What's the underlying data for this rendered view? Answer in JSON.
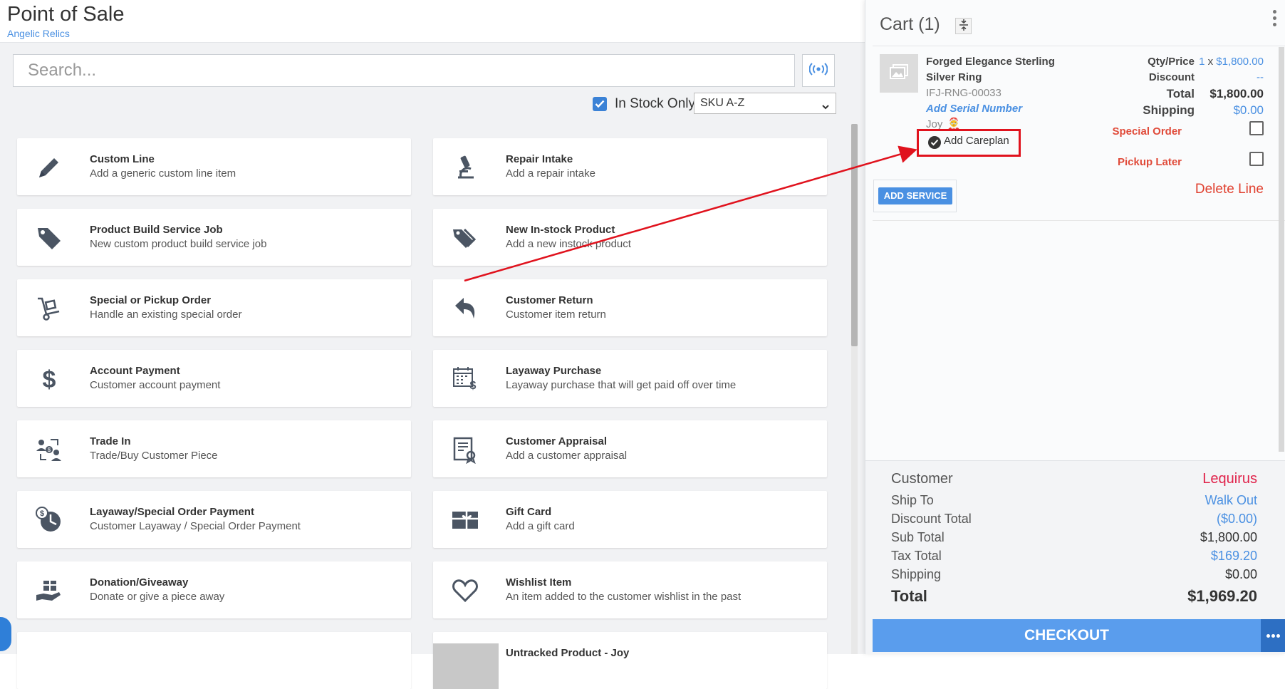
{
  "header": {
    "title": "Point of Sale",
    "store": "Angelic Relics"
  },
  "search": {
    "placeholder": "Search..."
  },
  "filters": {
    "in_stock_label": "In Stock Only",
    "in_stock_checked": true,
    "sort_value": "SKU A-Z"
  },
  "tiles": [
    {
      "title": "Custom Line",
      "subtitle": "Add a generic custom line item",
      "icon": "pencil-icon"
    },
    {
      "title": "Repair Intake",
      "subtitle": "Add a repair intake",
      "icon": "microscope-icon"
    },
    {
      "title": "Product Build Service Job",
      "subtitle": "New custom product build service job",
      "icon": "tag-icon"
    },
    {
      "title": "New In-stock Product",
      "subtitle": "Add a new instock product",
      "icon": "tags-icon"
    },
    {
      "title": "Special or Pickup Order",
      "subtitle": "Handle an existing special order",
      "icon": "dolly-icon"
    },
    {
      "title": "Customer Return",
      "subtitle": "Customer item return",
      "icon": "return-arrow-icon"
    },
    {
      "title": "Account Payment",
      "subtitle": "Customer account payment",
      "icon": "dollar-icon"
    },
    {
      "title": "Layaway Purchase",
      "subtitle": "Layaway purchase that will get paid off over time",
      "icon": "calendar-dollar-icon"
    },
    {
      "title": "Trade In",
      "subtitle": "Trade/Buy Customer Piece",
      "icon": "user-exchange-icon"
    },
    {
      "title": "Customer Appraisal",
      "subtitle": "Add a customer appraisal",
      "icon": "certificate-icon"
    },
    {
      "title": "Layaway/Special Order Payment",
      "subtitle": "Customer Layaway / Special Order Payment",
      "icon": "clock-dollar-icon"
    },
    {
      "title": "Gift Card",
      "subtitle": "Add a gift card",
      "icon": "gift-card-icon"
    },
    {
      "title": "Donation/Giveaway",
      "subtitle": "Donate or give a piece away",
      "icon": "hand-gift-icon"
    },
    {
      "title": "Wishlist Item",
      "subtitle": "An item added to the customer wishlist in the past",
      "icon": "heart-icon"
    },
    {
      "title": "",
      "subtitle": "",
      "icon": ""
    },
    {
      "title": "Untracked Product - Joy",
      "subtitle": "",
      "icon": ""
    }
  ],
  "cart": {
    "title": "Cart (1)",
    "item": {
      "name_line1": "Forged Elegance Sterling",
      "name_line2": "Silver Ring",
      "sku": "IFJ-RNG-00033",
      "add_serial": "Add Serial Number",
      "staff": "Joy",
      "add_careplan": "Add Careplan",
      "qty_price_label": "Qty/Price",
      "qty": "1",
      "qty_sep": "x",
      "price": "$1,800.00",
      "discount_label": "Discount",
      "discount_value": "--",
      "total_label": "Total",
      "total_value": "$1,800.00",
      "shipping_label": "Shipping",
      "shipping_value": "$0.00",
      "special_order_label": "Special Order",
      "pickup_later_label": "Pickup Later",
      "delete_line": "Delete Line",
      "add_service": "ADD SERVICE"
    }
  },
  "summary": {
    "customer_label": "Customer",
    "customer_value": "Lequirus",
    "ship_to_label": "Ship To",
    "ship_to_value": "Walk Out",
    "discount_total_label": "Discount Total",
    "discount_total_value": "($0.00)",
    "sub_total_label": "Sub Total",
    "sub_total_value": "$1,800.00",
    "tax_total_label": "Tax Total",
    "tax_total_value": "$169.20",
    "shipping_label": "Shipping",
    "shipping_value": "$0.00",
    "total_label": "Total",
    "total_value": "$1,969.20",
    "checkout_label": "CHECKOUT"
  },
  "colors": {
    "accent": "#4a90e2",
    "danger": "#e0121d",
    "checkout": "#5a9ded",
    "customer_name": "#e0224a"
  }
}
